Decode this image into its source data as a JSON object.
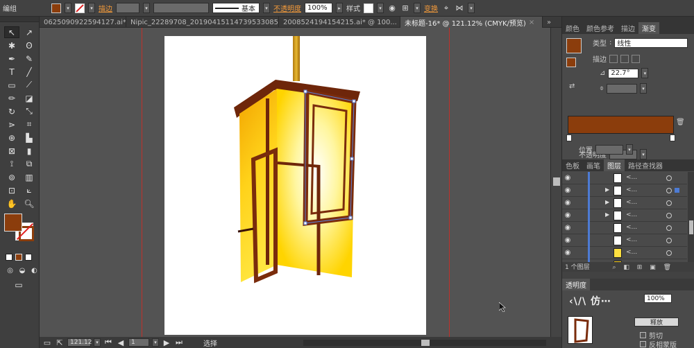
{
  "toolbar": {
    "mode_label": "编组",
    "stroke_label": "描边",
    "stroke_profile": "基本",
    "opacity_label": "不透明度",
    "opacity_value": "100%",
    "style_label": "样式",
    "transform_label": "变换",
    "fill_color": "#8b3d0c"
  },
  "tabs": [
    {
      "label": "0625090922594127.ai*",
      "active": false
    },
    {
      "label": "Nipic_22289708_20190415114739533085.ai*",
      "active": false
    },
    {
      "label": "2008524194154215.ai* @ 100...",
      "active": false
    },
    {
      "label": "未标题-16* @ 121.12% (CMYK/预览)",
      "active": true
    }
  ],
  "right_panel": {
    "tabs": [
      "颜色",
      "颜色参考",
      "描边",
      "渐变"
    ],
    "gradient": {
      "type_label": "类型",
      "type_value": "线性",
      "stroke_label": "描边",
      "angle_value": "22.7°",
      "opacity_label": "不透明度",
      "position_label": "位置",
      "stop_color": "#8b3d0c"
    },
    "layer_tabs": [
      "色板",
      "画笔",
      "图层",
      "路径查找器"
    ],
    "layer_count": "1 个图层",
    "bottom_tab": "透明度",
    "opacity_value": "100%",
    "release_label": "释放",
    "clip_label": "剪切",
    "invert_label": "反相蒙版"
  },
  "status": {
    "zoom": "121.12",
    "page": "1",
    "tool": "选择"
  }
}
